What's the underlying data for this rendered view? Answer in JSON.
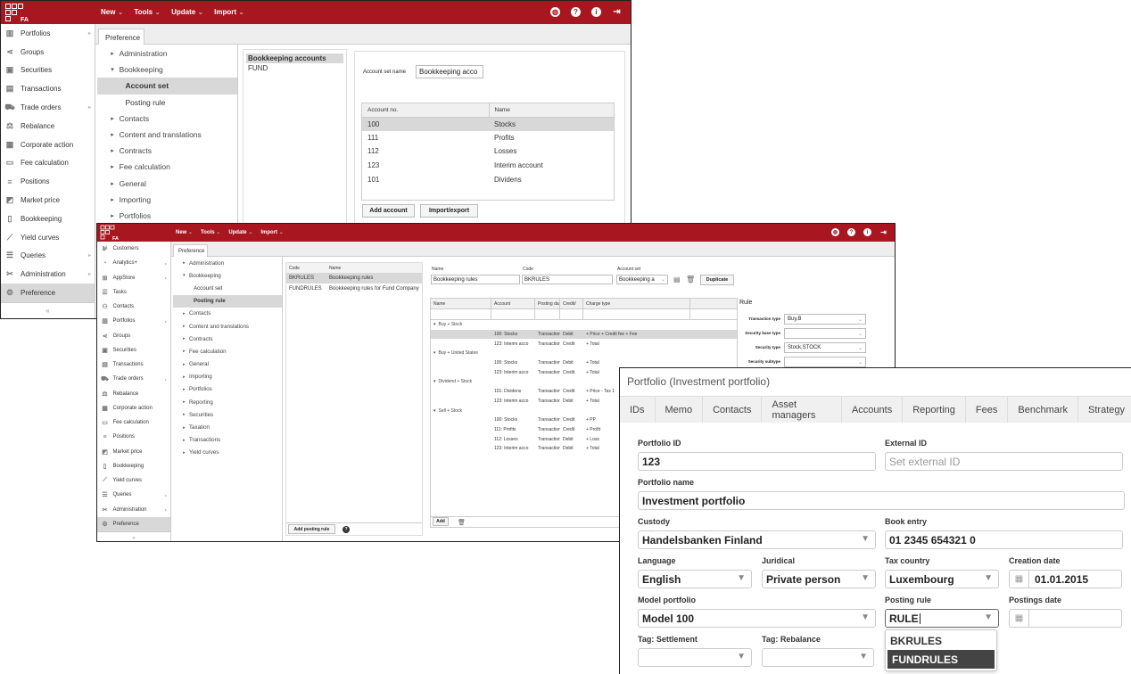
{
  "app": {
    "logo_text": "FA",
    "top_menu": [
      {
        "label": "New"
      },
      {
        "label": "Tools"
      },
      {
        "label": "Update"
      },
      {
        "label": "Import"
      }
    ],
    "caret": "⌄",
    "top_icons": [
      "globe-icon",
      "help-icon",
      "info-icon",
      "logout-icon"
    ]
  },
  "window1": {
    "sidebar": [
      {
        "label": "Portfolios",
        "icon": "portfolio-icon",
        "glyph": "▥",
        "submenu": true
      },
      {
        "label": "Groups",
        "icon": "share-icon",
        "glyph": "⋖",
        "submenu": false
      },
      {
        "label": "Securities",
        "icon": "securities-icon",
        "glyph": "▣",
        "submenu": false
      },
      {
        "label": "Transactions",
        "icon": "document-icon",
        "glyph": "▤",
        "submenu": false
      },
      {
        "label": "Trade orders",
        "icon": "cart-icon",
        "glyph": "⛟",
        "submenu": true
      },
      {
        "label": "Rebalance",
        "icon": "scale-icon",
        "glyph": "⚖",
        "submenu": false
      },
      {
        "label": "Corporate action",
        "icon": "building-icon",
        "glyph": "▦",
        "submenu": false
      },
      {
        "label": "Fee calculation",
        "icon": "fee-icon",
        "glyph": "▭",
        "submenu": false
      },
      {
        "label": "Positions",
        "icon": "list-icon",
        "glyph": "≡",
        "submenu": false
      },
      {
        "label": "Market price",
        "icon": "price-icon",
        "glyph": "◩",
        "submenu": false
      },
      {
        "label": "Bookkeeping",
        "icon": "book-icon",
        "glyph": "▯",
        "submenu": false
      },
      {
        "label": "Yield curves",
        "icon": "chart-icon",
        "glyph": "⟋",
        "submenu": false
      },
      {
        "label": "Queries",
        "icon": "queries-icon",
        "glyph": "☰",
        "submenu": true
      },
      {
        "label": "Administration",
        "icon": "tools-icon",
        "glyph": "✂",
        "submenu": true
      },
      {
        "label": "Preference",
        "icon": "gears-icon",
        "glyph": "⚙",
        "submenu": false,
        "selected": true
      }
    ],
    "collapse_label": "«",
    "tab": "Preference",
    "tree": [
      {
        "label": "Administration",
        "level": 0,
        "expanded": false
      },
      {
        "label": "Bookkeeping",
        "level": 0,
        "expanded": true
      },
      {
        "label": "Account set",
        "level": 1,
        "selected": true
      },
      {
        "label": "Posting rule",
        "level": 1
      },
      {
        "label": "Contacts",
        "level": 0,
        "expanded": false
      },
      {
        "label": "Content and translations",
        "level": 0,
        "expanded": false
      },
      {
        "label": "Contracts",
        "level": 0,
        "expanded": false
      },
      {
        "label": "Fee calculation",
        "level": 0,
        "expanded": false
      },
      {
        "label": "General",
        "level": 0,
        "expanded": false
      },
      {
        "label": "Importing",
        "level": 0,
        "expanded": false
      },
      {
        "label": "Portfolios",
        "level": 0,
        "expanded": false
      }
    ],
    "account_sets": [
      {
        "label": "Bookkeeping accounts",
        "selected": true
      },
      {
        "label": "FUND"
      }
    ],
    "account_set_name_label": "Account set name",
    "account_set_name_value": "Bookkeeping acco",
    "accounts_table": {
      "columns": [
        "Account no.",
        "Name"
      ],
      "rows": [
        [
          "100",
          "Stocks"
        ],
        [
          "111",
          "Profits"
        ],
        [
          "112",
          "Losses"
        ],
        [
          "123",
          "Interim account"
        ],
        [
          "101",
          "Dividens"
        ]
      ]
    },
    "add_account_label": "Add account",
    "import_export_label": "Import/export"
  },
  "window2": {
    "sidebar": [
      {
        "label": "Customers",
        "glyph": "⊯",
        "icon": "customers-icon",
        "submenu": false
      },
      {
        "label": "Analytics+",
        "glyph": "◔",
        "icon": "analytics-icon",
        "submenu": true
      },
      {
        "label": "AppStore",
        "glyph": "⊞",
        "icon": "appstore-icon",
        "submenu": true
      },
      {
        "label": "Tasks",
        "glyph": "☰",
        "icon": "tasks-icon",
        "submenu": false
      },
      {
        "label": "Contacts",
        "glyph": "⚇",
        "icon": "contacts-icon",
        "submenu": false
      },
      {
        "label": "Portfolios",
        "glyph": "▥",
        "icon": "portfolio-icon",
        "submenu": true
      },
      {
        "label": "Groups",
        "glyph": "⋖",
        "icon": "share-icon",
        "submenu": false
      },
      {
        "label": "Securities",
        "glyph": "▣",
        "icon": "securities-icon",
        "submenu": false
      },
      {
        "label": "Transactions",
        "glyph": "▤",
        "icon": "document-icon",
        "submenu": false
      },
      {
        "label": "Trade orders",
        "glyph": "⛟",
        "icon": "cart-icon",
        "submenu": true
      },
      {
        "label": "Rebalance",
        "glyph": "⚖",
        "icon": "scale-icon",
        "submenu": false
      },
      {
        "label": "Corporate action",
        "glyph": "▦",
        "icon": "building-icon",
        "submenu": false
      },
      {
        "label": "Fee calculation",
        "glyph": "▭",
        "icon": "fee-icon",
        "submenu": false
      },
      {
        "label": "Positions",
        "glyph": "≡",
        "icon": "list-icon",
        "submenu": false
      },
      {
        "label": "Market price",
        "glyph": "◩",
        "icon": "price-icon",
        "submenu": false
      },
      {
        "label": "Bookkeeping",
        "glyph": "▯",
        "icon": "book-icon",
        "submenu": false
      },
      {
        "label": "Yield curves",
        "glyph": "⟋",
        "icon": "chart-icon",
        "submenu": false
      },
      {
        "label": "Queries",
        "glyph": "☰",
        "icon": "queries-icon",
        "submenu": true
      },
      {
        "label": "Administration",
        "glyph": "✂",
        "icon": "tools-icon",
        "submenu": true
      },
      {
        "label": "Preference",
        "glyph": "⚙",
        "icon": "gears-icon",
        "submenu": false,
        "selected": true
      }
    ],
    "collapse_label": "«",
    "tab": "Preference",
    "tree": [
      {
        "label": "Administration",
        "level": 0,
        "expanded": false
      },
      {
        "label": "Bookkeeping",
        "level": 0,
        "expanded": true
      },
      {
        "label": "Account set",
        "level": 1
      },
      {
        "label": "Posting rule",
        "level": 1,
        "selected": true
      },
      {
        "label": "Contacts",
        "level": 0,
        "expanded": false
      },
      {
        "label": "Content and translations",
        "level": 0,
        "expanded": false
      },
      {
        "label": "Contracts",
        "level": 0,
        "expanded": false
      },
      {
        "label": "Fee calculation",
        "level": 0,
        "expanded": false
      },
      {
        "label": "General",
        "level": 0,
        "expanded": false
      },
      {
        "label": "Importing",
        "level": 0,
        "expanded": false
      },
      {
        "label": "Portfolios",
        "level": 0,
        "expanded": false
      },
      {
        "label": "Reporting",
        "level": 0,
        "expanded": false
      },
      {
        "label": "Securities",
        "level": 0,
        "expanded": false
      },
      {
        "label": "Taxation",
        "level": 0,
        "expanded": false
      },
      {
        "label": "Transactions",
        "level": 0,
        "expanded": false
      },
      {
        "label": "Yield curves",
        "level": 0,
        "expanded": false
      }
    ],
    "rules_table": {
      "columns": [
        "Code",
        "Name"
      ],
      "rows": [
        {
          "code": "BKRULES",
          "name": "Bookkeeping rules",
          "selected": true
        },
        {
          "code": "FUNDRULES",
          "name": "Bookkeeping rules for Fund Company"
        }
      ]
    },
    "add_posting_rule_label": "Add posting rule",
    "form": {
      "name_label": "Name",
      "name_value": "Bookkeeping rules",
      "code_label": "Code",
      "code_value": "BKRULES",
      "account_set_label": "Account set",
      "account_set_value": "Bookkeeping a",
      "duplicate_label": "Duplicate"
    },
    "postings_table": {
      "columns": [
        "Name",
        "Account",
        "Posting da",
        "Credit/",
        "Charge type"
      ],
      "groups": [
        {
          "name": "Buy + Stock",
          "rows": [
            {
              "account": "100: Stocks",
              "posting": "Transaction",
              "cd": "Debit",
              "charge": "+ Price + Credit fee + Fee",
              "selected": true
            },
            {
              "account": "123: Interim acco",
              "posting": "Transaction",
              "cd": "Credit",
              "charge": "+ Total"
            }
          ]
        },
        {
          "name": "Buy + United States",
          "rows": [
            {
              "account": "100: Stocks",
              "posting": "Transaction",
              "cd": "Debit",
              "charge": "+ Total"
            },
            {
              "account": "123: Interim acco",
              "posting": "Transaction",
              "cd": "Credit",
              "charge": "+ Total"
            }
          ]
        },
        {
          "name": "Dividend + Stock",
          "rows": [
            {
              "account": "101: Dividens",
              "posting": "Transaction",
              "cd": "Credit",
              "charge": "+ Price - Tax 1"
            },
            {
              "account": "123: Interim acco",
              "posting": "Transaction",
              "cd": "Debit",
              "charge": "+ Total"
            }
          ]
        },
        {
          "name": "Sell + Stock",
          "rows": [
            {
              "account": "100: Stocks",
              "posting": "Transaction",
              "cd": "Credit",
              "charge": "+ PP."
            },
            {
              "account": "111: Profits",
              "posting": "Transaction",
              "cd": "Credit",
              "charge": "+ Profit"
            },
            {
              "account": "112: Losses",
              "posting": "Transaction",
              "cd": "Debit",
              "charge": "+ Loss"
            },
            {
              "account": "123: Interim acco",
              "posting": "Transaction",
              "cd": "Debit",
              "charge": "+ Total"
            }
          ]
        }
      ]
    },
    "add_label": "Add",
    "rule": {
      "title": "Rule",
      "fields": [
        {
          "label": "Transaction type",
          "value": "Buy,B"
        },
        {
          "label": "Security base type",
          "value": ""
        },
        {
          "label": "Security type",
          "value": "Stock,STOCK"
        },
        {
          "label": "Security subtype",
          "value": ""
        }
      ]
    }
  },
  "window3": {
    "title": "Portfolio (Investment portfolio)",
    "tabs": [
      "IDs",
      "Memo",
      "Contacts",
      "Asset managers",
      "Accounts",
      "Reporting",
      "Fees",
      "Benchmark",
      "Strategy"
    ],
    "fields": {
      "portfolio_id": {
        "label": "Portfolio ID",
        "value": "123"
      },
      "external_id": {
        "label": "External ID",
        "placeholder": "Set external ID"
      },
      "portfolio_name": {
        "label": "Portfolio name",
        "value": "Investment portfolio"
      },
      "custody": {
        "label": "Custody",
        "value": "Handelsbanken Finland"
      },
      "book_entry": {
        "label": "Book entry",
        "value": "01 2345 654321 0"
      },
      "language": {
        "label": "Language",
        "value": "English"
      },
      "juridical": {
        "label": "Juridical",
        "value": "Private person"
      },
      "tax_country": {
        "label": "Tax country",
        "value": "Luxembourg"
      },
      "creation_date": {
        "label": "Creation date",
        "value": "01.01.2015"
      },
      "model_portfolio": {
        "label": "Model portfolio",
        "value": "Model 100"
      },
      "posting_rule": {
        "label": "Posting rule",
        "value": "RULE"
      },
      "postings_date": {
        "label": "Postings date",
        "value": ""
      },
      "tag_settlement": {
        "label": "Tag: Settlement",
        "value": ""
      },
      "tag_rebalance": {
        "label": "Tag: Rebalance",
        "value": ""
      }
    },
    "posting_rule_options": [
      {
        "label": "BKRULES"
      },
      {
        "label": "FUNDRULES",
        "highlighted": true
      }
    ]
  }
}
